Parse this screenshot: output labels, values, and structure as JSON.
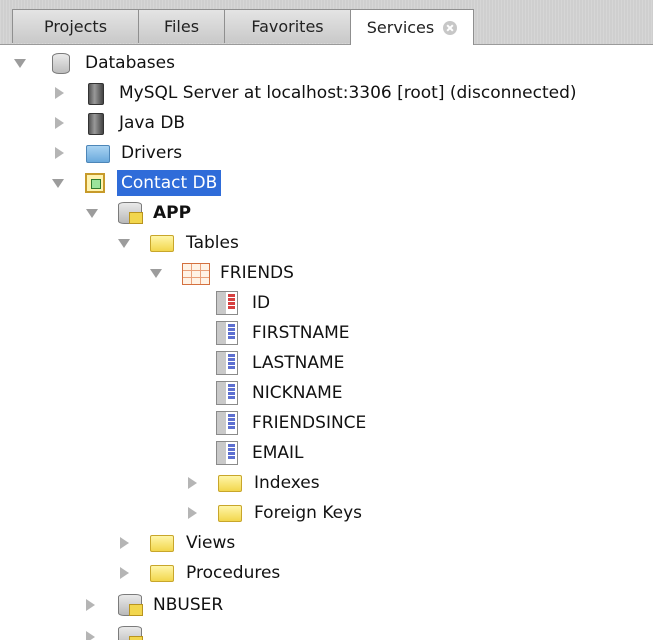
{
  "tabs": [
    {
      "label": "Projects"
    },
    {
      "label": "Files"
    },
    {
      "label": "Favorites"
    },
    {
      "label": "Services"
    }
  ],
  "tree": {
    "databases": "Databases",
    "mysql": "MySQL Server at localhost:3306 [root] (disconnected)",
    "javadb": "Java DB",
    "drivers": "Drivers",
    "contactdb": "Contact DB",
    "app": "APP",
    "tables": "Tables",
    "friends": "FRIENDS",
    "columns": [
      "ID",
      "FIRSTNAME",
      "LASTNAME",
      "NICKNAME",
      "FRIENDSINCE",
      "EMAIL"
    ],
    "indexes": "Indexes",
    "foreign_keys": "Foreign Keys",
    "views": "Views",
    "procedures": "Procedures",
    "nbuser": "NBUSER"
  },
  "colors": {
    "selection": "#2f6cd9",
    "tabbar": "#d3d3d3"
  }
}
